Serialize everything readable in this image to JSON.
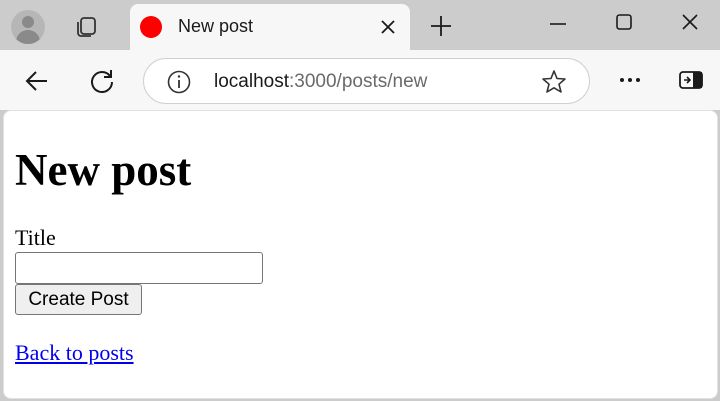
{
  "tab": {
    "title": "New post"
  },
  "address_bar": {
    "host": "localhost",
    "path": ":3000/posts/new"
  },
  "page": {
    "heading": "New post",
    "form": {
      "title_label": "Title",
      "title_value": "",
      "submit_label": "Create Post"
    },
    "back_link": "Back to posts"
  },
  "icons": {
    "profile": "profile-avatar-icon",
    "tab_actions": "tab-actions-icon",
    "favicon": "favicon-icon",
    "tab_close": "close-icon",
    "new_tab": "plus-icon",
    "minimize": "minimize-icon",
    "maximize": "maximize-icon",
    "window_close": "close-icon",
    "back": "back-arrow-icon",
    "reload": "reload-icon",
    "site_info": "info-icon",
    "favorite": "star-icon",
    "more": "more-icon",
    "sidebar": "sidebar-icon"
  },
  "colors": {
    "frame": "#cccccc",
    "toolbar": "#f7f7f7",
    "favicon": "#ff0000",
    "link": "#0000ee"
  }
}
